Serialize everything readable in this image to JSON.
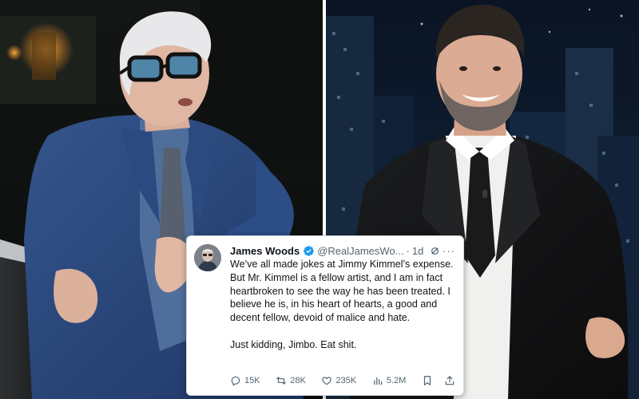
{
  "tweet": {
    "name": "James Woods",
    "handle": "@RealJamesWo...",
    "separator": "·",
    "time": "1d",
    "more_label": "···",
    "text_paragraph_1": "We’ve all made jokes at Jimmy Kimmel’s expense. But Mr. Kimmel is a fellow artist, and I am in fact heartbroken to see the way he has been treated. I believe he is, in his heart of hearts, a good and decent fellow, devoid of malice and hate.",
    "text_paragraph_2": "Just kidding, Jimbo. Eat shit.",
    "replies": "15K",
    "reposts": "28K",
    "likes": "235K",
    "views": "5.2M"
  },
  "icons": {
    "verified": "verified-badge-icon",
    "grok": "grok-icon",
    "more": "more-icon",
    "reply": "reply-icon",
    "repost": "repost-icon",
    "like": "like-icon",
    "views": "views-icon",
    "bookmark": "bookmark-icon",
    "share": "share-icon"
  },
  "colors": {
    "verified": "#1d9bf0",
    "text": "#0f1419",
    "secondary": "#536471",
    "card_background": "#ffffff"
  }
}
